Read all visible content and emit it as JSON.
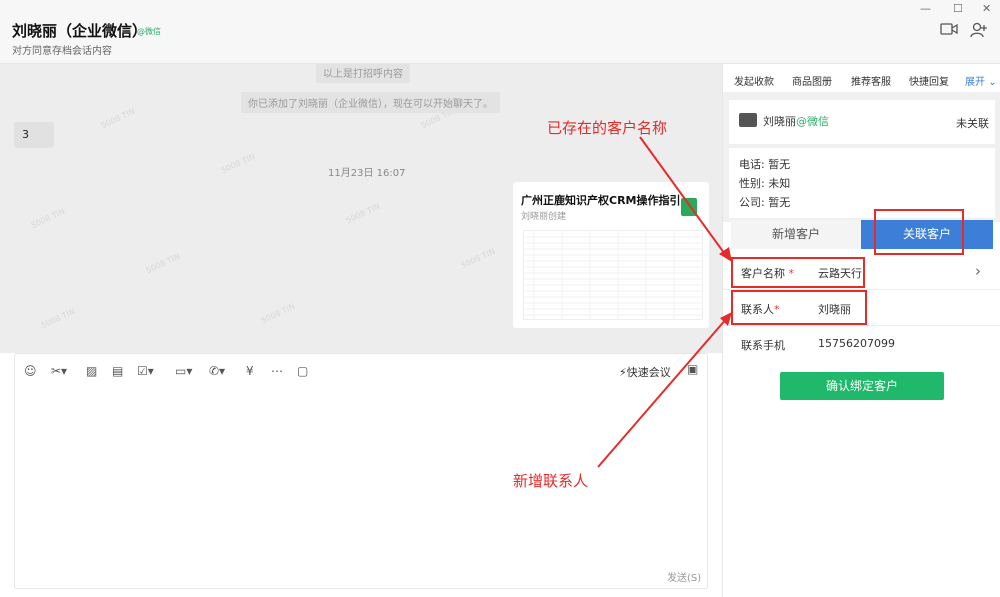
{
  "header": {
    "chat_name": "刘晓丽（企业微信）",
    "wechat_tag": "@微信",
    "subtitle": "对方同意存档会话内容"
  },
  "chat": {
    "system_msg_1": "以上是打招呼内容",
    "system_msg_2": "你已添加了刘晓丽（企业微信），现在可以开始聊天了。",
    "message_3": "3",
    "timestamp": "11月23日 16:07",
    "watermark": "5008 TIN",
    "file_card": {
      "title": "广州正鹿知识产权CRM操作指引",
      "creator": "刘晓丽创建"
    }
  },
  "composer": {
    "quick_meeting": "快速会议",
    "send": "发送(S)"
  },
  "right_panel": {
    "tabs": [
      "发起收款",
      "商品图册",
      "推荐客服",
      "快捷回复",
      "展开"
    ],
    "contact": {
      "name": "刘晓丽",
      "wx": "@微信",
      "status": "未关联"
    },
    "info": {
      "phone": "电话:  暂无",
      "gender": "性别:  未知",
      "company": "公司:  暂无"
    },
    "btn_new_customer": "新增客户",
    "btn_link_customer": "关联客户",
    "form": {
      "customer_label": "客户名称",
      "customer_value": "云路天行",
      "contact_label": "联系人",
      "contact_value": "刘晓丽",
      "phone_label": "联系手机",
      "phone_value": "15756207099",
      "required_mark": "*"
    },
    "confirm_button": "确认绑定客户"
  },
  "annotations": {
    "existing_customer": "已存在的客户名称",
    "new_contact": "新增联系人"
  },
  "colors": {
    "accent_blue": "#3d7fd8",
    "confirm_green": "#20b86a",
    "annotation_red": "#e62b2b"
  }
}
